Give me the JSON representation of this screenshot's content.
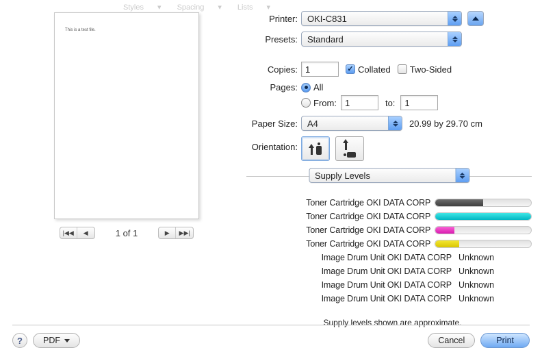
{
  "topbar": {
    "t1": "Styles",
    "t2": "Spacing",
    "t3": "Lists"
  },
  "preview": {
    "sample_text": "This is a test file."
  },
  "pager": {
    "label": "1 of 1",
    "first": "⏮",
    "prev": "◀",
    "next": "▶",
    "last": "⏭"
  },
  "labels": {
    "printer": "Printer:",
    "presets": "Presets:",
    "copies": "Copies:",
    "collated": "Collated",
    "two_sided": "Two-Sided",
    "pages": "Pages:",
    "all": "All",
    "from": "From:",
    "to": "to:",
    "paper_size": "Paper Size:",
    "paper_dims": "20.99 by 29.70 cm",
    "orientation": "Orientation:",
    "section": "Supply Levels",
    "approx": "Supply levels shown are approximate."
  },
  "values": {
    "printer": "OKI-C831",
    "preset": "Standard",
    "copies": "1",
    "from": "1",
    "to": "1",
    "paper_size": "A4"
  },
  "supplies": [
    {
      "label": "Toner Cartridge OKI DATA CORP",
      "kind": "bar",
      "color": "black",
      "pct": 50
    },
    {
      "label": "Toner Cartridge OKI DATA CORP",
      "kind": "bar",
      "color": "cyan",
      "pct": 100
    },
    {
      "label": "Toner Cartridge OKI DATA CORP",
      "kind": "bar",
      "color": "magenta",
      "pct": 20
    },
    {
      "label": "Toner Cartridge OKI DATA CORP",
      "kind": "bar",
      "color": "yellow",
      "pct": 25
    },
    {
      "label": "Image Drum Unit OKI DATA CORP",
      "kind": "text",
      "status": "Unknown"
    },
    {
      "label": "Image Drum Unit OKI DATA CORP",
      "kind": "text",
      "status": "Unknown"
    },
    {
      "label": "Image Drum Unit OKI DATA CORP",
      "kind": "text",
      "status": "Unknown"
    },
    {
      "label": "Image Drum Unit OKI DATA CORP",
      "kind": "text",
      "status": "Unknown"
    }
  ],
  "footer": {
    "help": "?",
    "pdf": "PDF",
    "cancel": "Cancel",
    "print": "Print"
  }
}
